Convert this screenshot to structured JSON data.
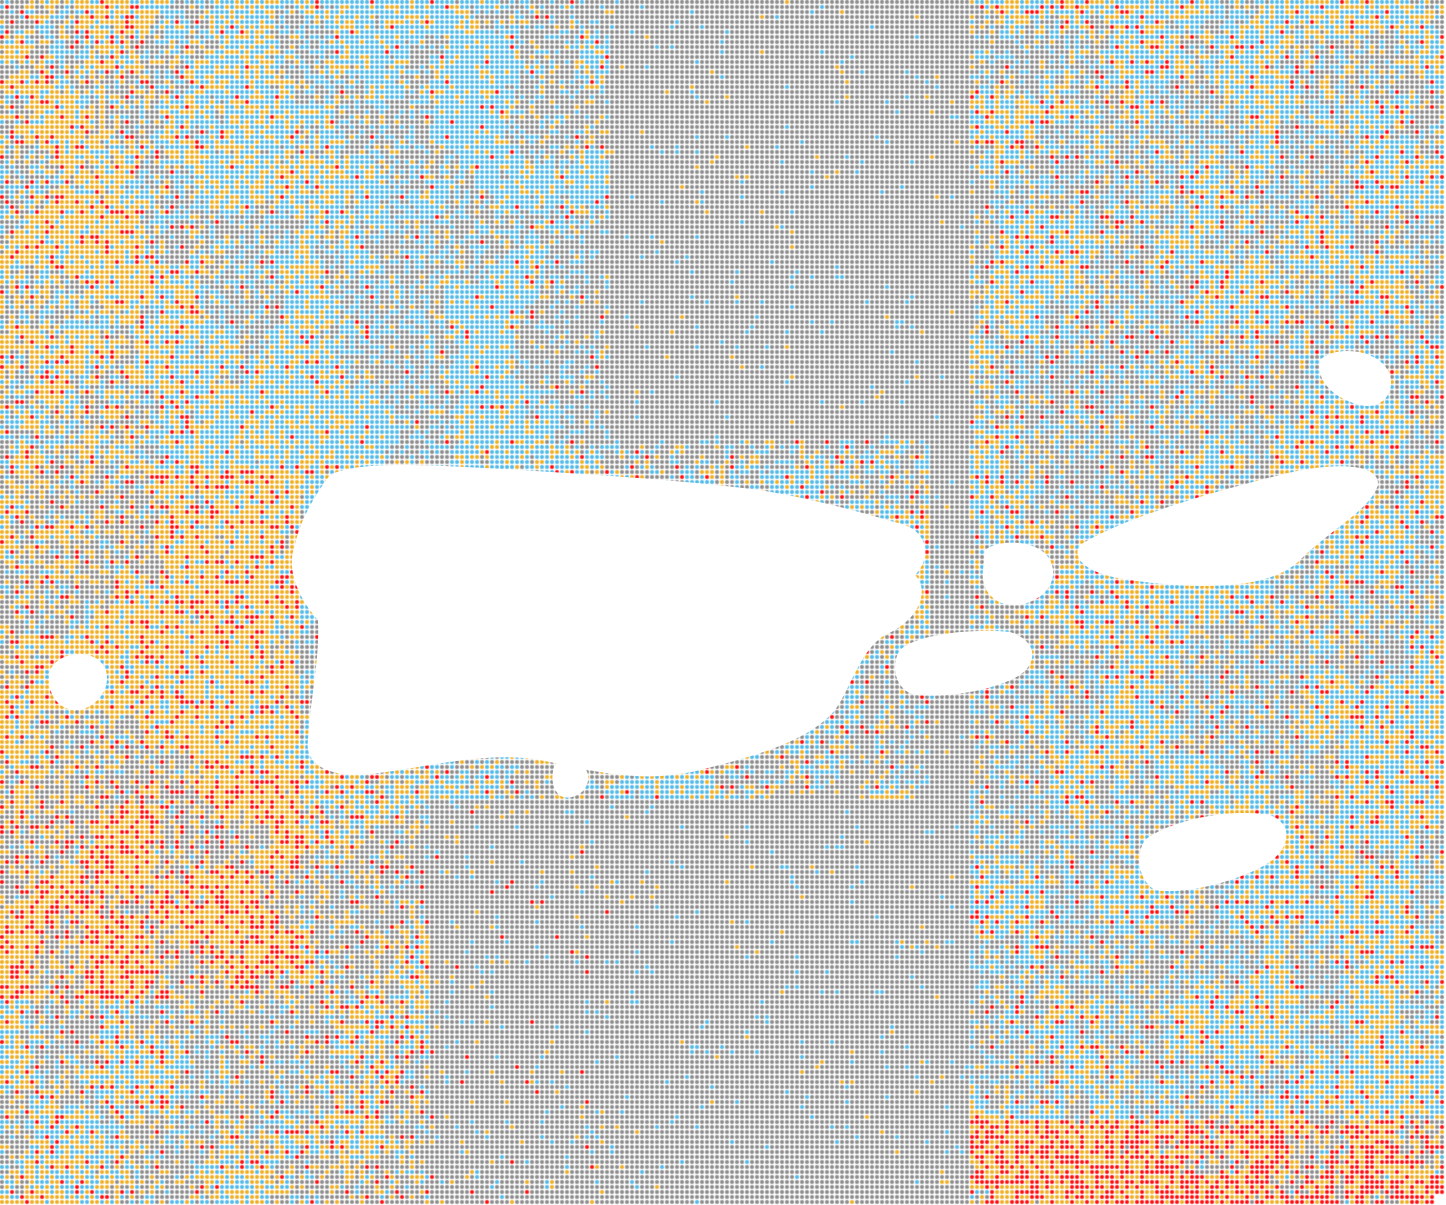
{
  "map": {
    "type": "classified-dot-grid",
    "background_color": "#ffffff",
    "grid_color": "#8a8a8a",
    "classes": [
      {
        "id": "class-blue",
        "color": "#4db8e8"
      },
      {
        "id": "class-orange",
        "color": "#f0ac1c"
      },
      {
        "id": "class-red",
        "color": "#ff0a0a"
      }
    ],
    "land_color": "#ffffff",
    "islands": [
      {
        "id": "main-island"
      },
      {
        "id": "west-islet"
      },
      {
        "id": "south-islet"
      },
      {
        "id": "east-island-upper-left"
      },
      {
        "id": "east-island-long"
      },
      {
        "id": "east-island-lower-left"
      },
      {
        "id": "east-island-upper-right"
      },
      {
        "id": "east-island-southeast"
      }
    ]
  }
}
